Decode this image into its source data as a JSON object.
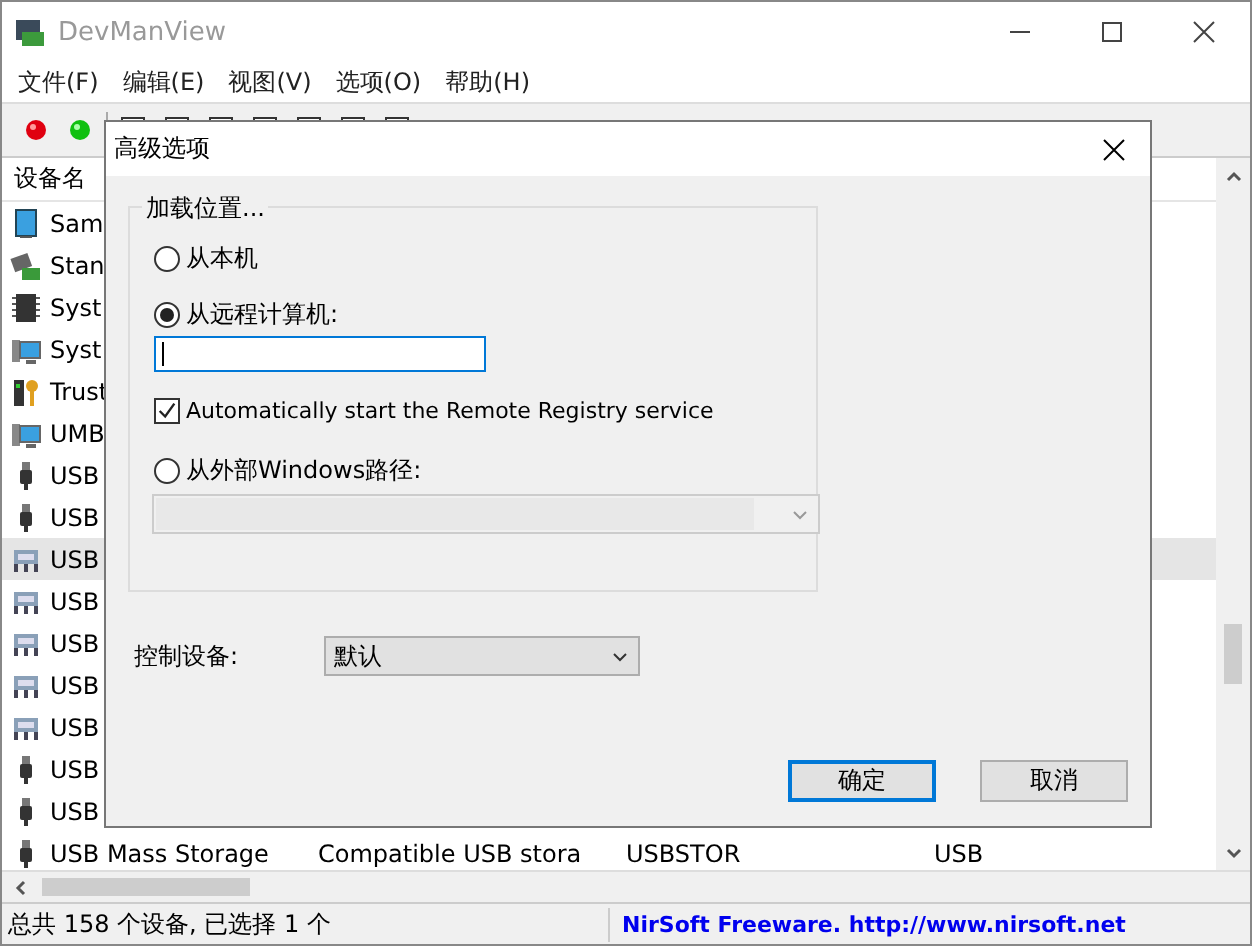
{
  "window": {
    "title": "DevManView"
  },
  "menu": [
    {
      "label": "文件(F)"
    },
    {
      "label": "编辑(E)"
    },
    {
      "label": "视图(V)"
    },
    {
      "label": "选项(O)"
    },
    {
      "label": "帮助(H)"
    }
  ],
  "toolbar": [
    {
      "kind": "stop"
    },
    {
      "kind": "go"
    },
    {
      "kind": "tool"
    },
    {
      "kind": "tool"
    },
    {
      "kind": "tool"
    },
    {
      "kind": "tool"
    },
    {
      "kind": "tool"
    },
    {
      "kind": "tool"
    },
    {
      "kind": "tool"
    }
  ],
  "table": {
    "columns": [
      "设备名"
    ],
    "rows": [
      {
        "kind": "monitor",
        "cells": [
          "Sam"
        ],
        "selected": false
      },
      {
        "kind": "board",
        "cells": [
          "Stan"
        ],
        "selected": false
      },
      {
        "kind": "chip",
        "cells": [
          "Syst"
        ],
        "selected": false
      },
      {
        "kind": "computer",
        "cells": [
          "Syst"
        ],
        "selected": false
      },
      {
        "kind": "key",
        "cells": [
          "Trust"
        ],
        "selected": false
      },
      {
        "kind": "computer",
        "cells": [
          "UMB"
        ],
        "selected": false
      },
      {
        "kind": "plug",
        "cells": [
          "USB"
        ],
        "selected": false
      },
      {
        "kind": "plug",
        "cells": [
          "USB"
        ],
        "selected": false
      },
      {
        "kind": "keyboard",
        "cells": [
          "USB"
        ],
        "selected": true
      },
      {
        "kind": "keyboard",
        "cells": [
          "USB"
        ],
        "selected": false
      },
      {
        "kind": "keyboard",
        "cells": [
          "USB"
        ],
        "selected": false
      },
      {
        "kind": "keyboard",
        "cells": [
          "USB"
        ],
        "selected": false
      },
      {
        "kind": "keyboard",
        "cells": [
          "USB"
        ],
        "selected": false
      },
      {
        "kind": "plug",
        "cells": [
          "USB"
        ],
        "selected": false
      },
      {
        "kind": "plug",
        "cells": [
          "USB"
        ],
        "selected": false
      },
      {
        "kind": "plug",
        "cells": [
          "USB Mass Storage",
          "Compatible USB stora",
          "USBSTOR",
          "USB"
        ],
        "selected": false
      }
    ]
  },
  "status_bar": {
    "left": "总共 158 个设备, 已选择 1 个",
    "right": "NirSoft Freeware.  http://www.nirsoft.net"
  },
  "dialog": {
    "title": "高级选项",
    "group": {
      "legend": "加载位置...",
      "options": [
        {
          "kind": "radio",
          "label": "从本机",
          "selected": false
        },
        {
          "kind": "radio",
          "label": "从远程计算机:",
          "selected": true
        },
        {
          "kind": "input"
        },
        {
          "kind": "checkbox",
          "label": "Automatically start the Remote Registry service",
          "checked": true
        },
        {
          "kind": "radio",
          "label": "从外部Windows路径:",
          "selected": false
        },
        {
          "kind": "combo",
          "disabled": true
        }
      ]
    },
    "control_label": "控制设备:",
    "control_value": "默认",
    "buttons": [
      {
        "label": "确定",
        "default": true
      },
      {
        "label": "取消",
        "default": false
      }
    ]
  }
}
